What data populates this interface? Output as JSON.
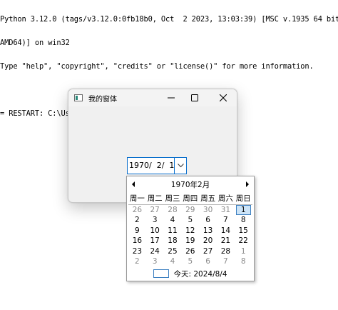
{
  "shell": {
    "lines": [
      "Python 3.12.0 (tags/v3.12.0:0fb18b0, Oct  2 2023, 13:03:39) [MSC v.1935 64 bit (",
      "AMD64)] on win32",
      "Type \"help\", \"copyright\", \"credits\" or \"license()\" for more information.",
      "",
      "= RESTART: C:\\Users\\love\\Documents\\Temp\\frame.py"
    ]
  },
  "window": {
    "title": "我的窗体"
  },
  "date_entry": {
    "value": "1970/  2/  1"
  },
  "calendar": {
    "month_label": "1970年2月",
    "weekdays": [
      "周一",
      "周二",
      "周三",
      "周四",
      "周五",
      "周六",
      "周日"
    ],
    "weeks": [
      [
        {
          "d": "26",
          "dim": true
        },
        {
          "d": "27",
          "dim": true
        },
        {
          "d": "28",
          "dim": true
        },
        {
          "d": "29",
          "dim": true
        },
        {
          "d": "30",
          "dim": true
        },
        {
          "d": "31",
          "dim": true
        },
        {
          "d": "1",
          "sel": true
        }
      ],
      [
        {
          "d": "2"
        },
        {
          "d": "3"
        },
        {
          "d": "4"
        },
        {
          "d": "5"
        },
        {
          "d": "6"
        },
        {
          "d": "7"
        },
        {
          "d": "8"
        }
      ],
      [
        {
          "d": "9"
        },
        {
          "d": "10"
        },
        {
          "d": "11"
        },
        {
          "d": "12"
        },
        {
          "d": "13"
        },
        {
          "d": "14"
        },
        {
          "d": "15"
        }
      ],
      [
        {
          "d": "16"
        },
        {
          "d": "17"
        },
        {
          "d": "18"
        },
        {
          "d": "19"
        },
        {
          "d": "20"
        },
        {
          "d": "21"
        },
        {
          "d": "22"
        }
      ],
      [
        {
          "d": "23"
        },
        {
          "d": "24"
        },
        {
          "d": "25"
        },
        {
          "d": "26"
        },
        {
          "d": "27"
        },
        {
          "d": "28"
        },
        {
          "d": "1",
          "dim": true
        }
      ],
      [
        {
          "d": "2",
          "dim": true
        },
        {
          "d": "3",
          "dim": true
        },
        {
          "d": "4",
          "dim": true
        },
        {
          "d": "5",
          "dim": true
        },
        {
          "d": "6",
          "dim": true
        },
        {
          "d": "7",
          "dim": true
        },
        {
          "d": "8",
          "dim": true
        }
      ]
    ],
    "today_label": "今天: 2024/8/4"
  },
  "colors": {
    "accent": "#0a6fcc",
    "selected_bg": "#cde4f7",
    "dim_text": "#8a8a8a"
  },
  "icons": {
    "app": "app-window-icon",
    "minimize": "minimize-icon",
    "maximize": "maximize-icon",
    "close": "close-icon",
    "dropdown": "chevron-down-icon",
    "prev": "triangle-left-icon",
    "next": "triangle-right-icon"
  }
}
